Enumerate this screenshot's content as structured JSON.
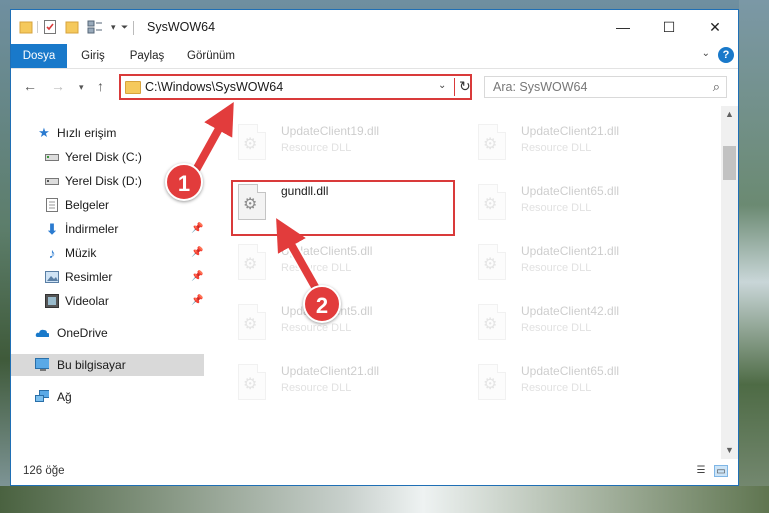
{
  "window": {
    "title": "SysWOW64",
    "minimize_glyph": "—",
    "maximize_glyph": "☐",
    "close_glyph": "✕"
  },
  "ribbon": {
    "tabs": [
      {
        "label": "Dosya",
        "active": true
      },
      {
        "label": "Giriş",
        "active": false
      },
      {
        "label": "Paylaş",
        "active": false
      },
      {
        "label": "Görünüm",
        "active": false
      }
    ],
    "help_glyph": "?",
    "collapse_glyph": "⌄"
  },
  "address": {
    "path": "C:\\Windows\\SysWOW64",
    "search_placeholder": "Ara: SysWOW64"
  },
  "nav_pane": {
    "items": [
      {
        "label": "Hızlı erişim",
        "icon": "star-icon"
      },
      {
        "label": "Yerel Disk (C:)",
        "icon": "drive-icon"
      },
      {
        "label": "Yerel Disk (D:)",
        "icon": "drive-icon"
      },
      {
        "label": "Belgeler",
        "icon": "documents-icon"
      },
      {
        "label": "İndirmeler",
        "icon": "download-icon"
      },
      {
        "label": "Müzik",
        "icon": "music-icon"
      },
      {
        "label": "Resimler",
        "icon": "pictures-icon"
      },
      {
        "label": "Videolar",
        "icon": "video-icon"
      },
      {
        "label": "OneDrive",
        "icon": "cloud-icon"
      },
      {
        "label": "Bu bilgisayar",
        "icon": "computer-icon",
        "selected": true
      },
      {
        "label": "Ağ",
        "icon": "network-icon"
      }
    ]
  },
  "files": [
    {
      "name": "UpdateClient19.dll",
      "type": "Resource DLL"
    },
    {
      "name": "UpdateClient21.dll",
      "type": "Resource DLL"
    },
    {
      "name": "gundll.dll",
      "type": ""
    },
    {
      "name": "UpdateClient65.dll",
      "type": "Resource DLL"
    },
    {
      "name": "UpdateClient5.dll",
      "type": "Resource DLL"
    },
    {
      "name": "UpdateClient21.dll",
      "type": "Resource DLL"
    },
    {
      "name": "UpdateClient5.dll",
      "type": "Resource DLL"
    },
    {
      "name": "UpdateClient42.dll",
      "type": "Resource DLL"
    },
    {
      "name": "UpdateClient21.dll",
      "type": "Resource DLL"
    },
    {
      "name": "UpdateClient65.dll",
      "type": "Resource DLL"
    }
  ],
  "status": {
    "item_count": "126 öğe"
  },
  "callouts": {
    "step1": "1",
    "step2": "2"
  },
  "colors": {
    "accent": "#1979ca",
    "highlight": "#d93a3a"
  }
}
